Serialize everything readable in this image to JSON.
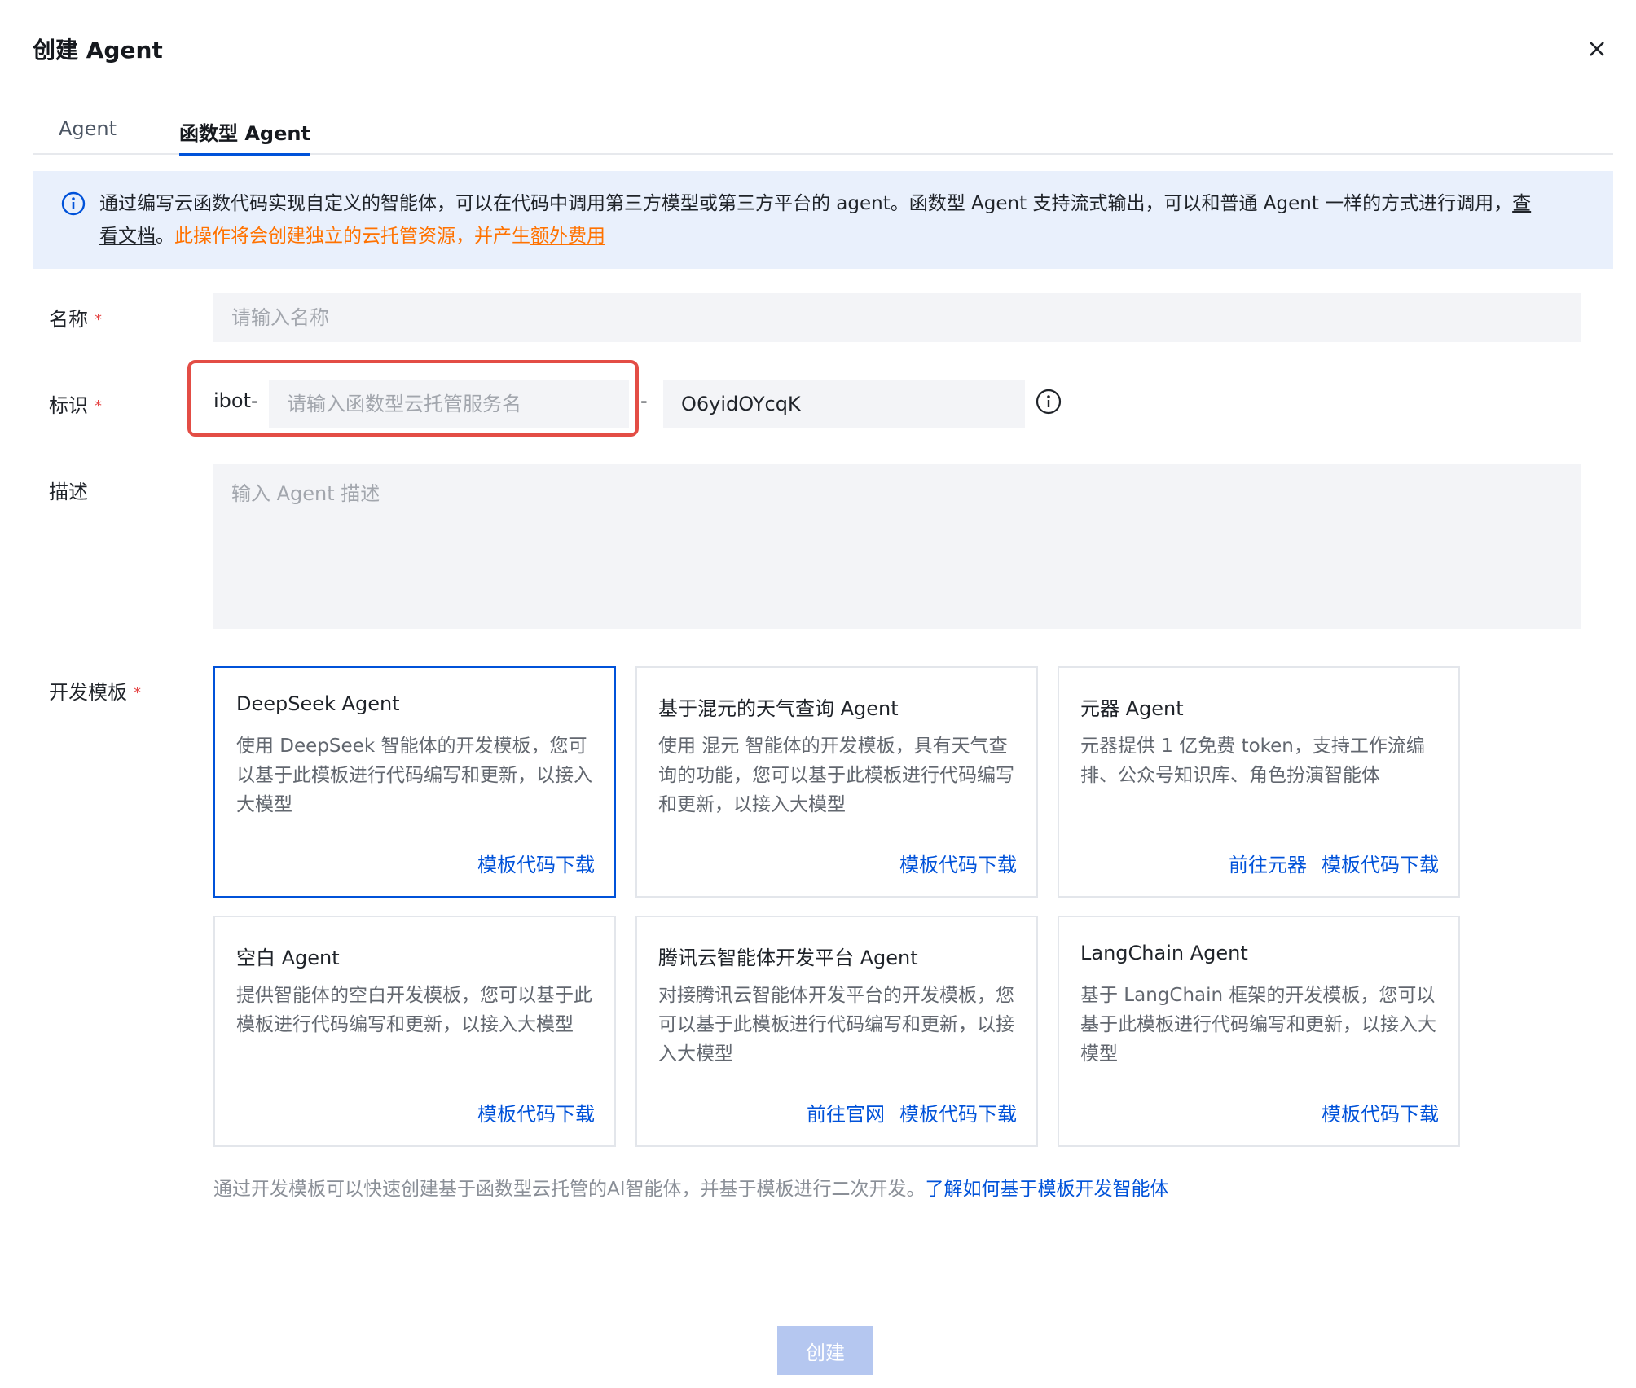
{
  "dialog": {
    "title": "创建 Agent",
    "close_icon": "close-icon"
  },
  "tabs": [
    {
      "label": "Agent",
      "active": false
    },
    {
      "label": "函数型 Agent",
      "active": true
    }
  ],
  "notice": {
    "icon": "info-icon",
    "text": "通过编写云函数代码实现自定义的智能体，可以在代码中调用第三方模型或第三方平台的 agent。函数型 Agent 支持流式输出，可以和普通 Agent 一样的方式进行调用，",
    "doc_link": "查看文档",
    "after_link": "。",
    "warning": "此操作将会创建独立的云托管资源，并产生",
    "warning_link": "额外费用"
  },
  "form": {
    "name": {
      "label": "名称",
      "placeholder": "请输入名称"
    },
    "identifier": {
      "label": "标识",
      "prefix": "ibot-",
      "placeholder": "请输入函数型云托管服务名",
      "separator": "-",
      "suffix_value": "O6yidOYcqK",
      "info_icon": "info-icon"
    },
    "description": {
      "label": "描述",
      "placeholder": "输入 Agent 描述"
    },
    "template": {
      "label": "开发模板"
    },
    "required_mark": "*"
  },
  "templates": [
    {
      "title": "DeepSeek Agent",
      "desc": "使用 DeepSeek 智能体的开发模板，您可以基于此模板进行代码编写和更新，以接入大模型",
      "links": [
        "模板代码下载"
      ],
      "selected": true
    },
    {
      "title": "基于混元的天气查询 Agent",
      "desc": "使用 混元 智能体的开发模板，具有天气查询的功能，您可以基于此模板进行代码编写和更新，以接入大模型",
      "links": [
        "模板代码下载"
      ],
      "selected": false
    },
    {
      "title": "元器 Agent",
      "desc": "元器提供 1 亿免费 token，支持工作流编排、公众号知识库、角色扮演智能体",
      "links": [
        "前往元器",
        "模板代码下载"
      ],
      "selected": false
    },
    {
      "title": "空白 Agent",
      "desc": "提供智能体的空白开发模板，您可以基于此模板进行代码编写和更新，以接入大模型",
      "links": [
        "模板代码下载"
      ],
      "selected": false
    },
    {
      "title": "腾讯云智能体开发平台 Agent",
      "desc": "对接腾讯云智能体开发平台的开发模板，您可以基于此模板进行代码编写和更新，以接入大模型",
      "links": [
        "前往官网",
        "模板代码下载"
      ],
      "selected": false
    },
    {
      "title": "LangChain Agent",
      "desc": "基于 LangChain 框架的开发模板，您可以基于此模板进行代码编写和更新，以接入大模型",
      "links": [
        "模板代码下载"
      ],
      "selected": false
    }
  ],
  "footnote": {
    "text": "通过开发模板可以快速创建基于函数型云托管的AI智能体，并基于模板进行二次开发。",
    "link": "了解如何基于模板开发智能体"
  },
  "submit": {
    "label": "创建"
  },
  "colors": {
    "accent": "#0052d9",
    "warning": "#ff7200",
    "highlight": "#e34d45",
    "notice_bg": "#e9f0fc"
  }
}
